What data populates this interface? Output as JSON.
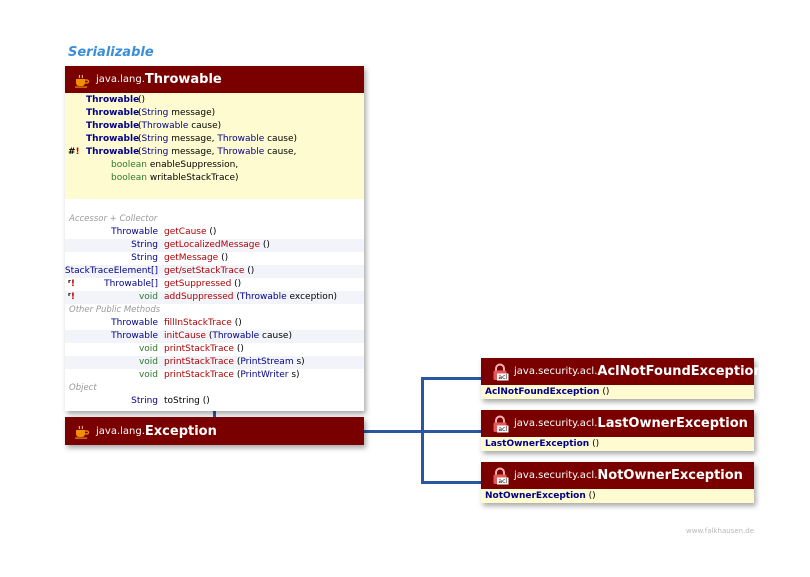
{
  "interface_label": "Serializable",
  "throwable": {
    "package": "java.lang.",
    "name": "Throwable",
    "ctor1_name": "Throwable",
    "ctor1_args": "()",
    "ctor2_name": "Throwable",
    "ctor2_open": "(",
    "ctor2_type": "String",
    "ctor2_rest": " message)",
    "ctor3_name": "Throwable",
    "ctor3_open": "(",
    "ctor3_type": "Throwable",
    "ctor3_rest": " cause)",
    "ctor4_name": "Throwable",
    "ctor4_open": "(",
    "ctor4_type": "String",
    "ctor4_mid": " message, ",
    "ctor4_type2": "Throwable",
    "ctor4_rest": " cause)",
    "ctor5_mark": "#",
    "ctor5_excl": "!",
    "ctor5_name": "Throwable",
    "ctor5_open": "(",
    "ctor5_type": "String",
    "ctor5_mid": " message, ",
    "ctor5_type2": "Throwable",
    "ctor5_rest": " cause,",
    "ctor5_line2_type": "boolean",
    "ctor5_line2_rest": " enableSuppression,",
    "ctor5_line3_type": "boolean",
    "ctor5_line3_rest": " writableStackTrace)",
    "cat_accessor": "Accessor + Collector",
    "m1_type": "Throwable",
    "m1_name": "getCause",
    "m1_args": " ()",
    "m2_type": "String",
    "m2_name": "getLocalizedMessage",
    "m2_args": " ()",
    "m3_type": "String",
    "m3_name": "getMessage",
    "m3_args": " ()",
    "m4_type": "StackTraceElement[]",
    "m4_name": "get/setStackTrace",
    "m4_args": " ()",
    "m5_mark": "ʳ",
    "m5_excl": "!",
    "m5_type": "Throwable[]",
    "m5_name": "getSuppressed",
    "m5_args": " ()",
    "m6_mark": "ʳ",
    "m6_excl": "!",
    "m6_type": "void",
    "m6_name": "addSuppressed",
    "m6_open": " (",
    "m6_argtype": "Throwable",
    "m6_rest": " exception)",
    "cat_public": "Other Public Methods",
    "p1_type": "Throwable",
    "p1_name": "fillInStackTrace",
    "p1_args": " ()",
    "p2_type": "Throwable",
    "p2_name": "initCause",
    "p2_open": " (",
    "p2_argtype": "Throwable",
    "p2_rest": " cause)",
    "p3_type": "void",
    "p3_name": "printStackTrace",
    "p3_args": " ()",
    "p4_type": "void",
    "p4_name": "printStackTrace",
    "p4_open": " (",
    "p4_argtype": "PrintStream",
    "p4_rest": " s)",
    "p5_type": "void",
    "p5_name": "printStackTrace",
    "p5_open": " (",
    "p5_argtype": "PrintWriter",
    "p5_rest": " s)",
    "cat_object": "Object",
    "o1_type": "String",
    "o1_name": "toString",
    "o1_args": " ()"
  },
  "exception": {
    "package": "java.lang.",
    "name": "Exception"
  },
  "subclasses": [
    {
      "package": "java.security.acl.",
      "name": "AclNotFoundException",
      "ctor": "AclNotFoundException",
      "args": " ()"
    },
    {
      "package": "java.security.acl.",
      "name": "LastOwnerException",
      "ctor": "LastOwnerException",
      "args": " ()"
    },
    {
      "package": "java.security.acl.",
      "name": "NotOwnerException",
      "ctor": "NotOwnerException",
      "args": " ()"
    }
  ],
  "lock_icon_label": "acl",
  "icons": {
    "class_icon": "coffee-cup-icon",
    "acl_icon": "lock-icon"
  },
  "colors": {
    "header": "#7a0000",
    "constructor_bg": "#fffbd0",
    "connector": "#2b56a0",
    "interface_label": "#3b8fd6"
  },
  "watermark": "www.falkhausen.de"
}
